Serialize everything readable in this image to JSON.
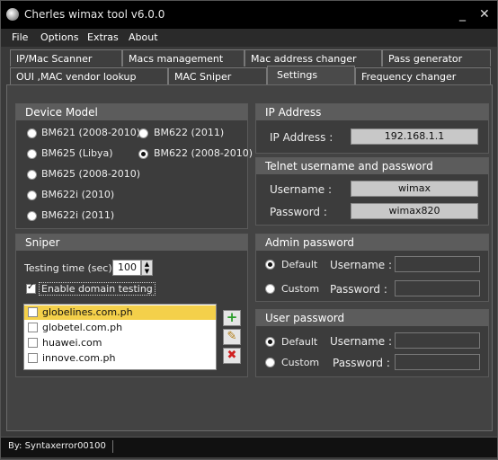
{
  "window": {
    "title": "Cherles wimax tool v6.0.0",
    "minimize": "_",
    "close": "✕"
  },
  "menu": [
    "File",
    "Options",
    "Extras",
    "About"
  ],
  "tabs_row1": [
    "IP/Mac Scanner",
    "Macs management",
    "Mac address changer",
    "Pass generator"
  ],
  "tabs_row2": [
    "OUI ,MAC vendor lookup",
    "MAC Sniper",
    "Settings",
    "Frequency changer"
  ],
  "device_model": {
    "title": "Device Model",
    "options": [
      {
        "label": "BM621 (2008-2010)",
        "selected": false
      },
      {
        "label": "BM622 (2011)",
        "selected": false
      },
      {
        "label": "BM625 (Libya)",
        "selected": false
      },
      {
        "label": "BM622 (2008-2010)",
        "selected": true
      },
      {
        "label": "BM625 (2008-2010)",
        "selected": false
      },
      {
        "label": "BM622i (2010)",
        "selected": false
      },
      {
        "label": "BM622i (2011)",
        "selected": false
      }
    ]
  },
  "ip_address": {
    "title": "IP Address",
    "label": "IP Address :",
    "value": "192.168.1.1"
  },
  "telnet": {
    "title": "Telnet username and password",
    "username_label": "Username :",
    "username": "wimax",
    "password_label": "Password :",
    "password": "wimax820"
  },
  "sniper": {
    "title": "Sniper",
    "testing_time_label": "Testing time (sec) :",
    "testing_time": "100",
    "enable_domain_label": "Enable domain testing",
    "enable_domain": true,
    "domains": [
      {
        "name": "globelines.com.ph",
        "checked": false,
        "selected": true
      },
      {
        "name": "globetel.com.ph",
        "checked": false,
        "selected": false
      },
      {
        "name": "huawei.com",
        "checked": false,
        "selected": false
      },
      {
        "name": "innove.com.ph",
        "checked": false,
        "selected": false
      }
    ],
    "add_icon": "+",
    "edit_icon": "✎",
    "delete_icon": "✖"
  },
  "admin_password": {
    "title": "Admin password",
    "default_label": "Default",
    "custom_label": "Custom",
    "username_label": "Username :",
    "password_label": "Password :",
    "mode": "default"
  },
  "user_password": {
    "title": "User password",
    "default_label": "Default",
    "custom_label": "Custom",
    "username_label": "Username :",
    "password_label": "Password :",
    "mode": "default"
  },
  "status": {
    "text": "By: Syntaxerror00100"
  }
}
